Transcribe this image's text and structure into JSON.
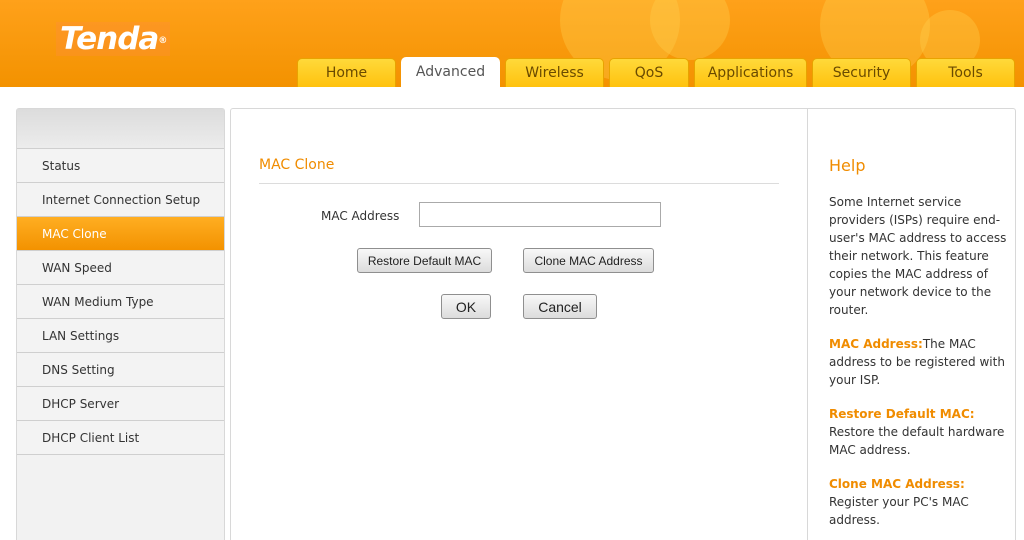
{
  "header": {
    "logo_text": "Tenda",
    "logo_mark": "®",
    "tabs": [
      {
        "label": "Home",
        "active": false
      },
      {
        "label": "Advanced",
        "active": true
      },
      {
        "label": "Wireless",
        "active": false
      },
      {
        "label": "QoS",
        "active": false
      },
      {
        "label": "Applications",
        "active": false
      },
      {
        "label": "Security",
        "active": false
      },
      {
        "label": "Tools",
        "active": false
      }
    ]
  },
  "sidebar": {
    "items": [
      {
        "label": "Status",
        "active": false
      },
      {
        "label": "Internet Connection Setup",
        "active": false
      },
      {
        "label": "MAC Clone",
        "active": true
      },
      {
        "label": "WAN Speed",
        "active": false
      },
      {
        "label": "WAN Medium Type",
        "active": false
      },
      {
        "label": "LAN Settings",
        "active": false
      },
      {
        "label": "DNS Setting",
        "active": false
      },
      {
        "label": "DHCP Server",
        "active": false
      },
      {
        "label": "DHCP Client List",
        "active": false
      }
    ]
  },
  "main": {
    "title": "MAC Clone",
    "mac_label": "MAC Address",
    "mac_value": "",
    "restore_label": "Restore Default MAC",
    "clone_label": "Clone MAC Address",
    "ok_label": "OK",
    "cancel_label": "Cancel"
  },
  "help": {
    "title": "Help",
    "intro": "Some Internet service providers (ISPs) require end-user's MAC address to access their network. This feature copies the MAC address of your network device to the router.",
    "entries": [
      {
        "term": "MAC Address:",
        "text": "The MAC address to be registered with your ISP."
      },
      {
        "term": "Restore Default MAC:",
        "text": "Restore the default hardware MAC address."
      },
      {
        "term": "Clone MAC Address:",
        "text": "Register your PC's MAC address."
      }
    ]
  },
  "colors": {
    "brand_orange": "#f39200",
    "tab_yellow": "#ffc20e",
    "accent_text": "#f08c00"
  }
}
